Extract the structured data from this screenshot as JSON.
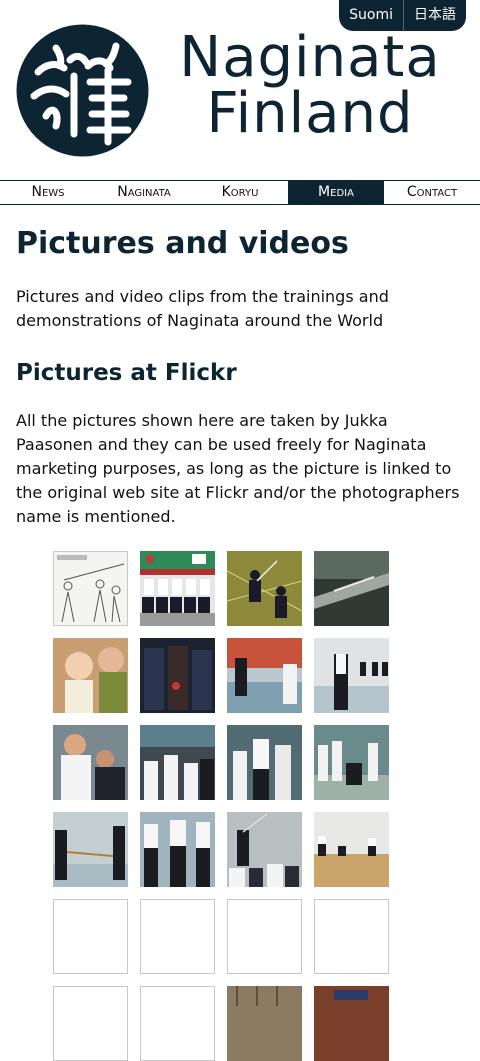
{
  "language_links": [
    "Suomi",
    "日本語"
  ],
  "site_title_line1": "Naginata",
  "site_title_line2": "Finland",
  "logo_mark": "kanji-brush-logo",
  "nav": {
    "items": [
      "News",
      "Naginata",
      "Koryu",
      "Media",
      "Contact"
    ],
    "active": "Media"
  },
  "page_title": "Pictures and videos",
  "intro": "Pictures and video clips from the trainings and demonstrations of Naginata around the World",
  "section_title": "Pictures at Flickr",
  "section_text": "All the pictures shown here are taken by Jukka Paasonen and they can be used freely for Naginata marketing purposes, as long as the picture is linked to the original web site at Flickr and/or the photographers name is mentioned.",
  "colors": {
    "brand": "#0d2533",
    "text": "#111111",
    "thumb_border": "#c8c8c8"
  },
  "gallery": {
    "loaded_thumbnails": 16,
    "placeholder_thumbnails": 4,
    "partial_bottom_thumbnails": 4
  }
}
